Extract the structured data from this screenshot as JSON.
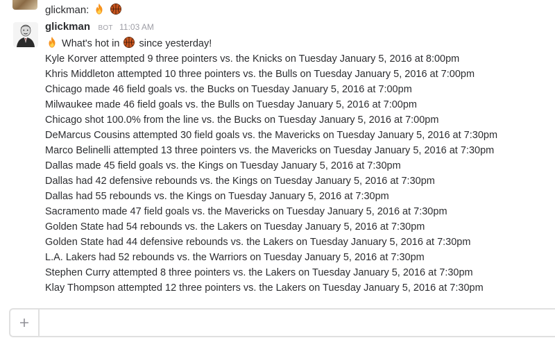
{
  "previous_message": {
    "author": "glickman:",
    "emojis": [
      "fire-emoji",
      "basketball-emoji"
    ]
  },
  "message": {
    "author": "glickman",
    "badge": "BOT",
    "timestamp": "11:03 AM",
    "intro": {
      "before": "What's hot in",
      "after": "since yesterday!"
    },
    "lines": [
      "Kyle Korver attempted 9 three pointers vs. the Knicks on Tuesday January  5, 2016 at  8:00pm",
      "Khris Middleton attempted 10 three pointers vs. the Bulls on Tuesday January  5, 2016 at  7:00pm",
      "Chicago made 46 field goals vs. the Bucks on Tuesday January  5, 2016 at  7:00pm",
      "Milwaukee made 46 field goals vs. the Bulls on Tuesday January  5, 2016 at  7:00pm",
      "Chicago shot 100.0% from the line vs. the Bucks on Tuesday January  5, 2016 at  7:00pm",
      "DeMarcus Cousins attempted 30 field goals vs. the Mavericks on Tuesday January  5, 2016 at  7:30pm",
      "Marco Belinelli attempted 13 three pointers vs. the Mavericks on Tuesday January  5, 2016 at  7:30pm",
      "Dallas made 45 field goals vs. the Kings on Tuesday January  5, 2016 at  7:30pm",
      "Dallas had 42 defensive rebounds vs. the Kings on Tuesday January  5, 2016 at  7:30pm",
      "Dallas had 55 rebounds vs. the Kings on Tuesday January  5, 2016 at  7:30pm",
      "Sacramento made 47 field goals vs. the Mavericks on Tuesday January  5, 2016 at  7:30pm",
      "Golden State had 54 rebounds vs. the Lakers on Tuesday January  5, 2016 at  7:30pm",
      "Golden State had 44 defensive rebounds vs. the Lakers on Tuesday January  5, 2016 at  7:30pm",
      "L.A. Lakers had 52 rebounds vs. the Warriors on Tuesday January  5, 2016 at  7:30pm",
      "Stephen Curry attempted 8 three pointers vs. the Lakers on Tuesday January  5, 2016 at  7:30pm",
      "Klay Thompson attempted 12 three pointers vs. the Lakers on Tuesday January  5, 2016 at  7:30pm"
    ]
  },
  "composer": {
    "add_icon": "plus-icon",
    "placeholder": ""
  },
  "colors": {
    "text": "#2c2d30",
    "muted": "#9e9ea6",
    "border": "#e0e0e0",
    "fire": "#f7931e",
    "basketball": "#c8551f"
  }
}
